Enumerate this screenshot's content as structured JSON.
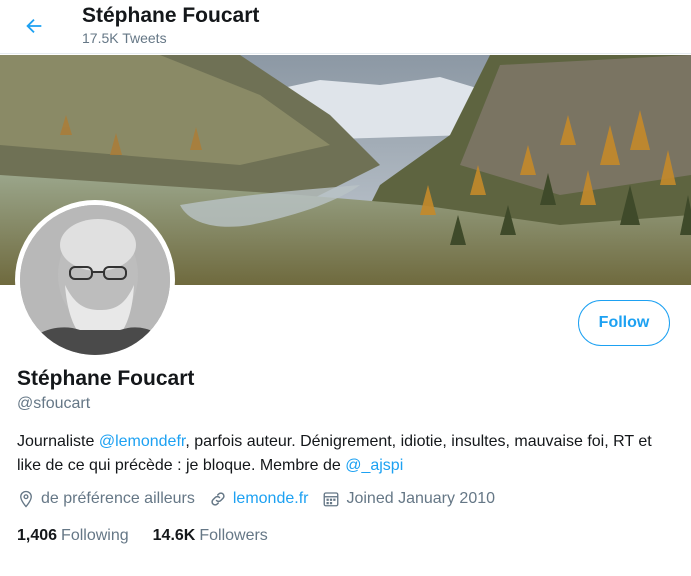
{
  "header": {
    "title": "Stéphane Foucart",
    "tweet_count": "17.5K Tweets"
  },
  "profile": {
    "name": "Stéphane Foucart",
    "handle": "@sfoucart",
    "follow_label": "Follow",
    "bio": {
      "part1": "Journaliste ",
      "mention1": "@lemondefr",
      "part2": ", parfois auteur. Dénigrement, idiotie, insultes, mauvaise foi, RT et like de ce qui précède : je bloque. Membre de ",
      "mention2": "@_ajspi"
    },
    "location": "de préférence ailleurs",
    "website": "lemonde.fr",
    "joined": "Joined January 2010",
    "following_count": "1,406",
    "following_label": "Following",
    "followers_count": "14.6K",
    "followers_label": "Followers"
  },
  "colors": {
    "accent": "#1da1f2",
    "secondary_text": "#657786",
    "primary_text": "#14171a"
  },
  "icons": {
    "back": "arrow-left-icon",
    "location": "location-pin-icon",
    "website": "link-icon",
    "joined": "calendar-icon"
  }
}
